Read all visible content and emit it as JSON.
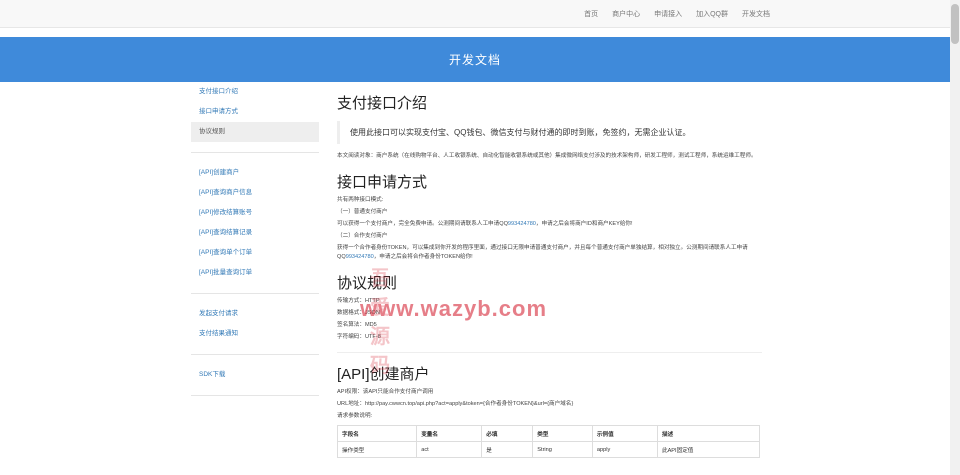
{
  "top_nav": [
    "首页",
    "商户中心",
    "申请接入",
    "加入QQ群",
    "开发文档"
  ],
  "hero_title": "开发文档",
  "sidebar": {
    "groups": [
      {
        "items": [
          {
            "label": "支付接口介绍",
            "active": false
          },
          {
            "label": "接口申请方式",
            "active": false
          },
          {
            "label": "协议规则",
            "active": true
          }
        ]
      },
      {
        "items": [
          {
            "label": "[API]创建商户",
            "active": false
          },
          {
            "label": "[API]查询商户信息",
            "active": false
          },
          {
            "label": "[API]修改结算账号",
            "active": false
          },
          {
            "label": "[API]查询结算记录",
            "active": false
          },
          {
            "label": "[API]查询单个订单",
            "active": false
          },
          {
            "label": "[API]批量查询订单",
            "active": false
          }
        ]
      },
      {
        "items": [
          {
            "label": "发起支付请求",
            "active": false
          },
          {
            "label": "支付结果通知",
            "active": false
          }
        ]
      },
      {
        "items": [
          {
            "label": "SDK下载",
            "active": false
          }
        ]
      }
    ]
  },
  "content": {
    "intro": {
      "title": "支付接口介绍",
      "quote": "使用此接口可以实现支付宝、QQ钱包、微信支付与财付通的即时到账，免签约，无需企业认证。",
      "desc": "本文阅读对象：商户系统（在线购物平台、人工收银系统、自动化智能收银系统或其他）集成微网络支付涉及的技术架构师，研发工程师，测试工程师，系统运维工程师。"
    },
    "apply": {
      "title": "接口申请方式",
      "line1": "共有两种接口模式:",
      "mode1_title": "（一）普通支付商户",
      "mode1_pre": "可以获得一个支付商户，完全免费申请。公测期间请联系人工申请QQ",
      "qq": "993424780",
      "mode1_post": "，申请之后会将商户ID和商户KEY给你!",
      "mode2_title": "（二）合作支付商户",
      "mode2_line": "获得一个合作者身份TOKEN，可以集成到你开发的程序里面，通过接口无限申请普通支付商户，并且每个普通支付商户单独结算，相对独立。公测期间请联系人工申请QQ",
      "mode2_post": "，申请之后会将合作者身份TOKEN给你!"
    },
    "protocol": {
      "title": "协议规则",
      "lines": [
        "传输方式：HTTP",
        "数据格式：JSON",
        "签名算法：MD5",
        "字符编码：UTF-8"
      ]
    },
    "create_merchant": {
      "title": "[API]创建商户",
      "permission": "API权限：该API只能合作支付商户调用",
      "url": "URL地址：http://pay.cwwcn.top/api.php?act=apply&token={合作者身份TOKEN}&url={商户域名}",
      "params_label": "请求参数说明:",
      "table": {
        "headers": [
          "字段名",
          "变量名",
          "必填",
          "类型",
          "示例值",
          "描述"
        ],
        "rows": [
          [
            "操作类型",
            "act",
            "是",
            "String",
            "apply",
            "此API固定值"
          ]
        ]
      }
    }
  },
  "watermark": {
    "cn": "吾爱源码",
    "url": "www.wazyb.com"
  }
}
